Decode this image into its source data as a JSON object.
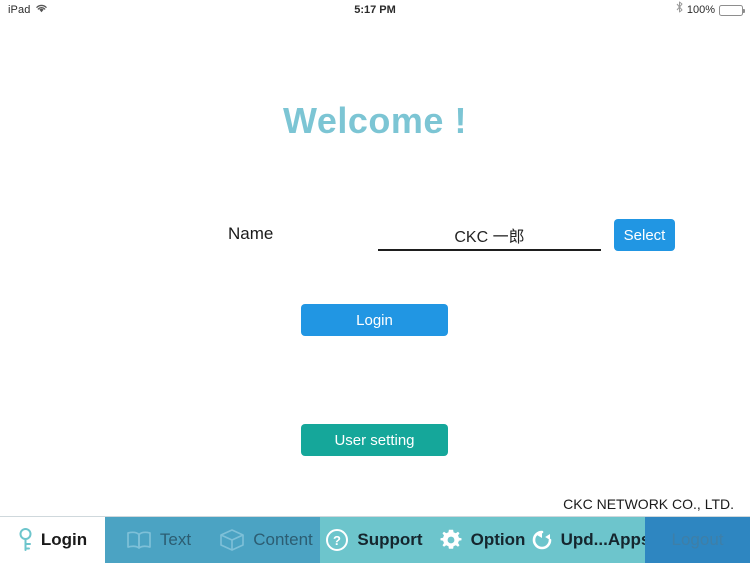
{
  "statusbar": {
    "carrier": "iPad",
    "wifi_icon": "wifi-icon",
    "time": "5:17 PM",
    "bluetooth_icon": "bluetooth-icon",
    "battery_percent": "100%",
    "battery_icon": "battery-full-icon"
  },
  "main": {
    "welcome_title": "Welcome !",
    "name_label": "Name",
    "name_value": "CKC 一郎",
    "name_placeholder": "",
    "select_label": "Select",
    "login_label": "Login",
    "user_setting_label": "User setting",
    "company": "CKC NETWORK CO., LTD."
  },
  "tabbar": {
    "items": [
      {
        "label": "Login",
        "icon": "key-icon",
        "active": true
      },
      {
        "label": "Text",
        "icon": "book-icon",
        "active": false
      },
      {
        "label": "Content",
        "icon": "box-icon",
        "active": false
      },
      {
        "label": "Support",
        "icon": "help-icon",
        "active": false
      },
      {
        "label": "Option",
        "icon": "gear-icon",
        "active": false
      },
      {
        "label": "Upd...Apps",
        "icon": "refresh-icon",
        "active": false
      },
      {
        "label": "Logout",
        "icon": "none",
        "active": false
      }
    ]
  },
  "colors": {
    "accent_blue": "#2196e3",
    "teal_button": "#15a79a",
    "welcome_teal": "#7cc5d4",
    "tab_blue": "#4ba3c3",
    "tab_teal": "#6dc5cc",
    "tab_logout": "#2e86c1"
  }
}
